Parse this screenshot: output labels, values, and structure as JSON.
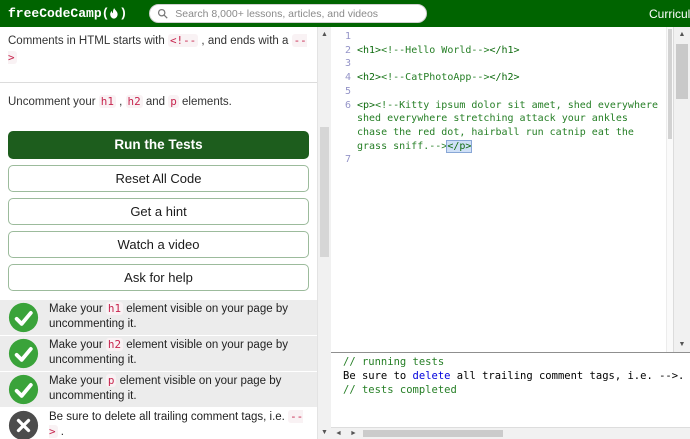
{
  "navbar": {
    "logo_prefix": "freeCodeCamp(",
    "logo_suffix": ")",
    "search_placeholder": "Search 8,000+ lessons, articles, and videos",
    "curriculum_label": "Curriculum"
  },
  "icons": {
    "scroll_up": "▲",
    "scroll_down": "▼",
    "scroll_left": "◄",
    "scroll_right": "►"
  },
  "left_panel": {
    "instruction_1": [
      {
        "t": "Comments in HTML starts with "
      },
      {
        "t": "<!--",
        "code": true
      },
      {
        "t": " , and ends with a "
      },
      {
        "t": "-->",
        "code": true
      }
    ],
    "instruction_2": [
      {
        "t": "Uncomment your "
      },
      {
        "t": "h1",
        "code": true
      },
      {
        "t": " , "
      },
      {
        "t": "h2",
        "code": true
      },
      {
        "t": " and "
      },
      {
        "t": "p",
        "code": true
      },
      {
        "t": " elements."
      }
    ],
    "run_button": "Run the Tests",
    "buttons": [
      "Reset All Code",
      "Get a hint",
      "Watch a video",
      "Ask for help"
    ],
    "tests": [
      {
        "status": "pass",
        "segments": [
          {
            "t": "Make your "
          },
          {
            "t": "h1",
            "code": true
          },
          {
            "t": " element visible on your page by uncommenting it."
          }
        ]
      },
      {
        "status": "pass",
        "segments": [
          {
            "t": "Make your "
          },
          {
            "t": "h2",
            "code": true
          },
          {
            "t": " element visible on your page by uncommenting it."
          }
        ]
      },
      {
        "status": "pass",
        "segments": [
          {
            "t": "Make your "
          },
          {
            "t": "p",
            "code": true
          },
          {
            "t": " element visible on your page by uncommenting it."
          }
        ]
      },
      {
        "status": "fail",
        "segments": [
          {
            "t": "Be sure to delete all trailing comment tags, i.e. "
          },
          {
            "t": "-->",
            "code": true
          },
          {
            "t": " ."
          }
        ]
      }
    ]
  },
  "editor": {
    "lines": [
      {
        "num": "1",
        "tokens": []
      },
      {
        "num": "2",
        "tokens": [
          {
            "t": "<h1>",
            "c": "tag"
          },
          {
            "t": "<!--Hello World-->",
            "c": "comment"
          },
          {
            "t": "</h1>",
            "c": "tag"
          }
        ]
      },
      {
        "num": "3",
        "tokens": []
      },
      {
        "num": "4",
        "tokens": [
          {
            "t": "<h2>",
            "c": "tag"
          },
          {
            "t": "<!--CatPhotoApp-->",
            "c": "comment"
          },
          {
            "t": "</h2>",
            "c": "tag"
          }
        ]
      },
      {
        "num": "5",
        "tokens": []
      },
      {
        "num": "6",
        "tokens": [
          {
            "t": "<p>",
            "c": "tag"
          },
          {
            "t": "<!--Kitty ipsum dolor sit amet, shed everywhere",
            "c": "comment"
          }
        ]
      },
      {
        "num": "",
        "tokens": [
          {
            "t": "shed everywhere stretching attack your ankles",
            "c": "comment"
          }
        ]
      },
      {
        "num": "",
        "tokens": [
          {
            "t": "chase the red dot, hairball run catnip eat the",
            "c": "comment"
          }
        ]
      },
      {
        "num": "",
        "tokens": [
          {
            "t": "grass sniff.-->",
            "c": "comment"
          },
          {
            "t": "</p>",
            "c": "tag sel"
          }
        ]
      },
      {
        "num": "7",
        "tokens": []
      }
    ]
  },
  "console": {
    "lines": [
      {
        "tokens": [
          {
            "t": "// running tests",
            "c": "comment"
          }
        ]
      },
      {
        "tokens": [
          {
            "t": "Be sure to ",
            "c": "plain"
          },
          {
            "t": "delete",
            "c": "link"
          },
          {
            "t": " all trailing comment tags, i.e. -->.",
            "c": "plain"
          }
        ]
      },
      {
        "tokens": [
          {
            "t": "// tests completed",
            "c": "comment"
          }
        ]
      }
    ]
  },
  "colors": {
    "navbar_bg": "#006400",
    "run_button_bg": "#1d5d1d",
    "outline_border": "#9cbb9c",
    "check_green": "#3aa33a",
    "fail_gray": "#4c4c4c",
    "code_red": "#c7254e",
    "code_bg": "#f9f2f4",
    "tag_green": "#0f6b0f",
    "comment_green": "#267f26",
    "line_number": "#9494c8",
    "link_blue": "#0000dd",
    "selection_bg": "#cfe0f7",
    "selection_border": "#89a7d6"
  }
}
